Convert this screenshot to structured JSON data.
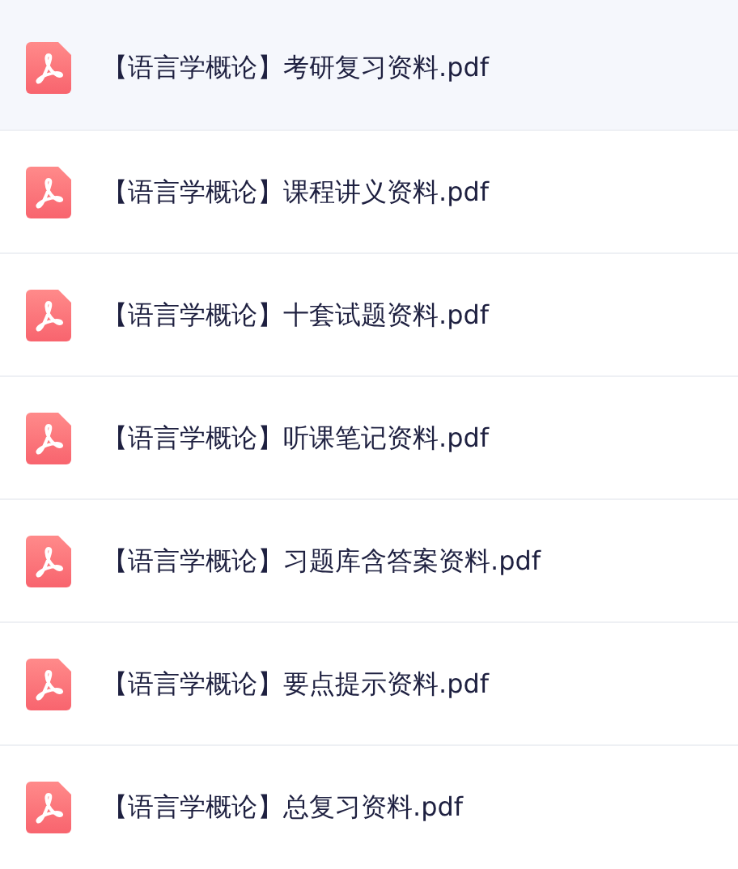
{
  "files": [
    {
      "name": "【语言学概论】考研复习资料.pdf",
      "selected": true
    },
    {
      "name": "【语言学概论】课程讲义资料.pdf",
      "selected": false
    },
    {
      "name": "【语言学概论】十套试题资料.pdf",
      "selected": false
    },
    {
      "name": "【语言学概论】听课笔记资料.pdf",
      "selected": false
    },
    {
      "name": "【语言学概论】习题库含答案资料.pdf",
      "selected": false
    },
    {
      "name": "【语言学概论】要点提示资料.pdf",
      "selected": false
    },
    {
      "name": "【语言学概论】总复习资料.pdf",
      "selected": false
    }
  ]
}
